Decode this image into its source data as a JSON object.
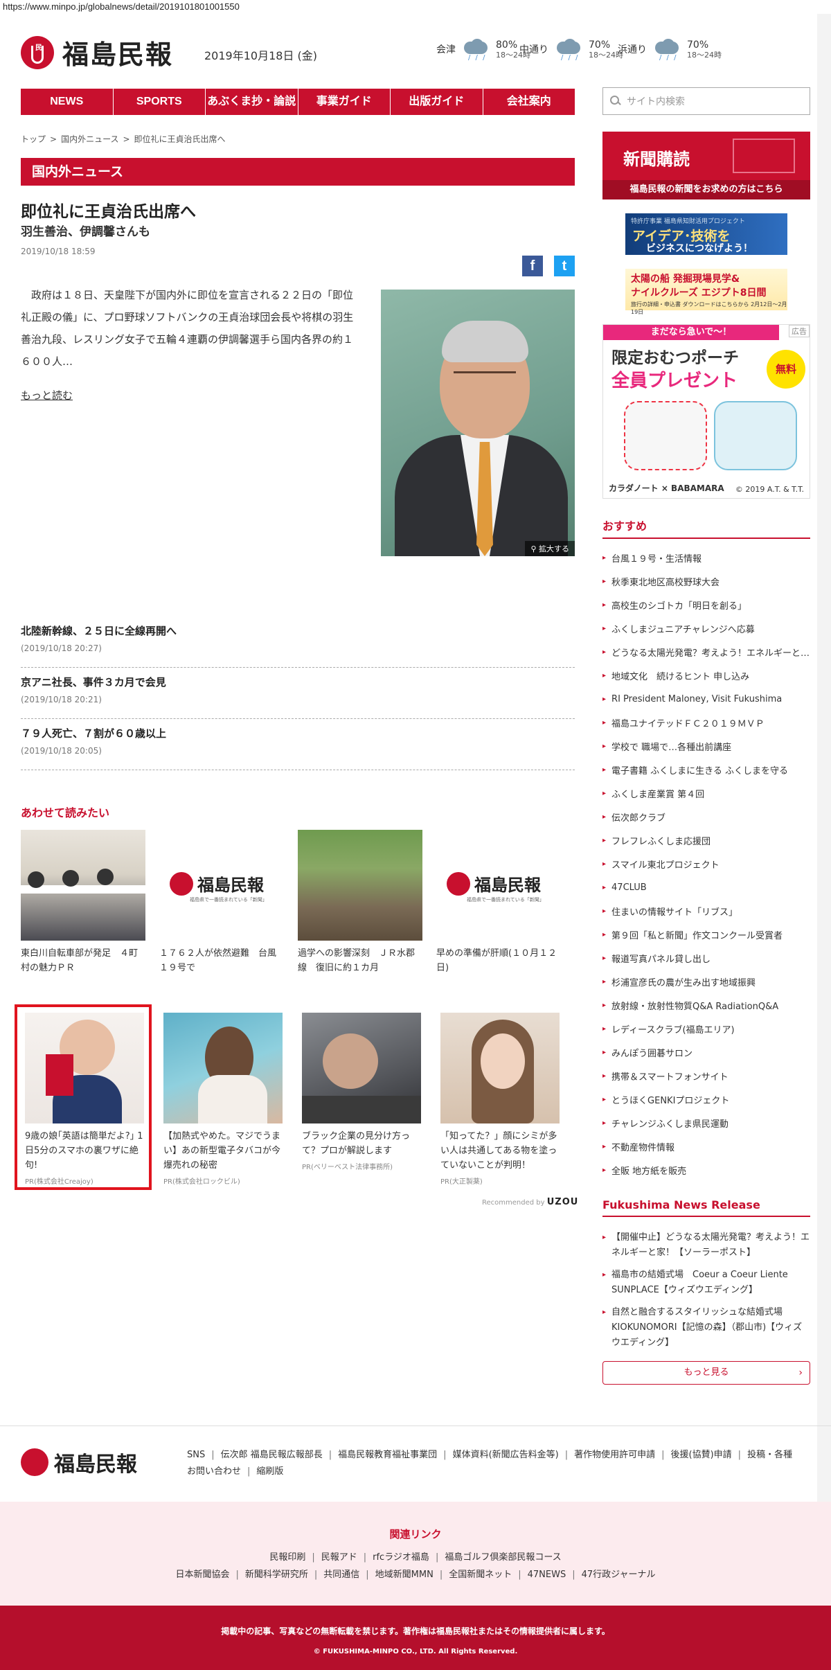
{
  "url": "https://www.minpo.jp/globalnews/detail/2019101801001550",
  "header": {
    "logo_text": "福島民報",
    "date": "2019年10月18日 (金)",
    "weather": [
      {
        "location": "会津",
        "pct": "80%",
        "hours": "18〜24時"
      },
      {
        "location": "中通り",
        "pct": "70%",
        "hours": "18〜24時"
      },
      {
        "location": "浜通り",
        "pct": "70%",
        "hours": "18〜24時"
      }
    ]
  },
  "nav": [
    "NEWS",
    "SPORTS",
    "あぶくま抄・論説",
    "事業ガイド",
    "出版ガイド",
    "会社案内"
  ],
  "search": {
    "placeholder": "サイト内検索"
  },
  "breadcrumb": [
    "トップ",
    "国内外ニュース",
    "即位礼に王貞治氏出席へ"
  ],
  "section_title": "国内外ニュース",
  "article": {
    "title": "即位礼に王貞治氏出席へ",
    "subtitle": "羽生善治、伊調馨さんも",
    "date": "2019/10/18 18:59",
    "body": "　政府は１８日、天皇陛下が国内外に即位を宣言される２２日の「即位礼正殿の儀」に、プロ野球ソフトバンクの王貞治球団会長や将棋の羽生善治九段、レスリング女子で五輪４連覇の伊調馨選手ら国内各界の約１６００人…",
    "read_more": "もっと読む",
    "zoom": "拡大する",
    "share_fb": "f",
    "share_tw": "t"
  },
  "related": [
    {
      "title": "北陸新幹線、２５日に全線再開へ",
      "date": "(2019/10/18 20:27)"
    },
    {
      "title": "京アニ社長、事件３カ月で会見",
      "date": "(2019/10/18 20:21)"
    },
    {
      "title": "７９人死亡、７割が６０歳以上",
      "date": "(2019/10/18 20:05)"
    }
  ],
  "also_read": {
    "title": "あわせて読みたい",
    "row1": [
      {
        "caption": "東白川自転車部が発足　４町村の魅力ＰＲ",
        "img": "meeting"
      },
      {
        "caption": "１７６２人が依然避難　台風１９号で",
        "img": "logo"
      },
      {
        "caption": "過学への影響深刻　ＪＲ水郡線　復旧に約１カ月",
        "img": "debris"
      },
      {
        "caption": "早めの準備が肝順(１０月１２日)",
        "img": "logo"
      }
    ],
    "row2": [
      {
        "caption": "9歳の娘｢英語は簡単だよ?｣ 1日5分のスマホの裏ワザに絶句!",
        "pr": "PR(株式会社Creajoy)",
        "img": "girl"
      },
      {
        "caption": "【加熱式やめた。マジでうまい】あの新型電子タバコが今爆売れの秘密",
        "pr": "PR(株式会社ロックビル)",
        "img": "woman-sea"
      },
      {
        "caption": "ブラック企業の見分け方って？プロが解説します",
        "pr": "PR(ベリーベスト法律事務所)",
        "img": "desk"
      },
      {
        "caption": "「知ってた？」顔にシミが多い人は共通してある物を塗っていないことが判明！",
        "pr": "PR(大正製薬)",
        "img": "portrait"
      }
    ],
    "logo_sub": "福島県で一番読まれている「新聞」",
    "recommended_by": "Recommended by",
    "recommended_brand": "UZOU"
  },
  "sidebar": {
    "subscribe_title": "新聞購読",
    "subscribe_sub": "福島民報の新聞をお求めの方はこちら",
    "ad1": {
      "top": "特許庁事業  福島県知財活用プロジェクト",
      "main": "アイデア･技術を",
      "sub": "ビジネスにつなげよう！"
    },
    "ad2": {
      "l1": "太陽の船 発掘現場見学&",
      "l2": "ナイルクルーズ エジプト8日間",
      "l3": "旅行の詳細・申込書 ダウンロードはこちらから  2月12日〜2月19日"
    },
    "ad3": {
      "top": "まだなら急いで〜！",
      "tag": "広告",
      "l1": "限定おむつポーチ",
      "l2": "全員プレゼント",
      "free": "無料",
      "foot": "カラダノート × BABAMARA",
      "copy": "© 2019 A.T. & T.T."
    },
    "osusume_title": "おすすめ",
    "osusume": [
      "台風１９号・生活情報",
      "秋季東北地区高校野球大会",
      "高校生のシゴトカ「明日を創る」",
      "ふくしまジュニアチャレンジへ応募",
      "どうなる太陽光発電？考えよう！エネルギーと家！",
      "地域文化　続けるヒント 申し込み",
      "RI President Maloney, Visit Fukushima",
      "福島ユナイテッドＦＣ２０１９ＭＶＰ",
      "学校で 職場で…各種出前講座",
      "電子書籍 ふくしまに生きる ふくしまを守る",
      "ふくしま産業賞 第４回",
      "伝次郎クラブ",
      "フレフレふくしま応援団",
      "スマイル東北プロジェクト",
      "47CLUB",
      "住まいの情報サイト「リブス」",
      "第９回「私と新聞」作文コンクール受賞者",
      "報道写真パネル貸し出し",
      "杉浦宣彦氏の農が生み出す地域振興",
      "放射線・放射性物質Q&A RadiationQ&A",
      "レディースクラブ(福島エリア)",
      "みんぽう囲碁サロン",
      "携帯＆スマートフォンサイト",
      "とうほくGENKIプロジェクト",
      "チャレンジふくしま県民運動",
      "不動産物件情報",
      "全販 地方紙を販売"
    ],
    "news_release_title": "Fukushima News Release",
    "news_release": [
      "【開催中止】どうなる太陽光発電？考えよう！エネルギーと家！【ソーラーポスト】",
      "福島市の結婚式場　Coeur a Coeur Liente SUNPLACE【ウィズウエディング】",
      "自然と融合するスタイリッシュな結婚式場　　KIOKUNOMORI【記憶の森】（郡山市)【ウィズウエディング】"
    ],
    "more": "もっと見る"
  },
  "footer": {
    "logo_text": "福島民報",
    "links": [
      "SNS",
      "伝次郎 福島民報広報部長",
      "福島民報教育福祉事業団",
      "媒体資料(新聞広告料金等)",
      "著作物使用許可申請",
      "後援(協賛)申請",
      "投稿・各種お問い合わせ",
      "縮刷版"
    ],
    "related_title": "関連リンク",
    "related_row1": [
      "民報印刷",
      "民報アド",
      "rfcラジオ福島",
      "福島ゴルフ倶楽部民報コース"
    ],
    "related_row2": [
      "日本新聞協会",
      "新聞科学研究所",
      "共同通信",
      "地域新聞MMN",
      "全国新聞ネット",
      "47NEWS",
      "47行政ジャーナル"
    ],
    "notice": "掲載中の記事、写真などの無断転載を禁じます。著作権は福島民報社またはその情報提供者に属します。",
    "copyright": "© FUKUSHIMA-MINPO CO., LTD. All Rights Reserved."
  }
}
